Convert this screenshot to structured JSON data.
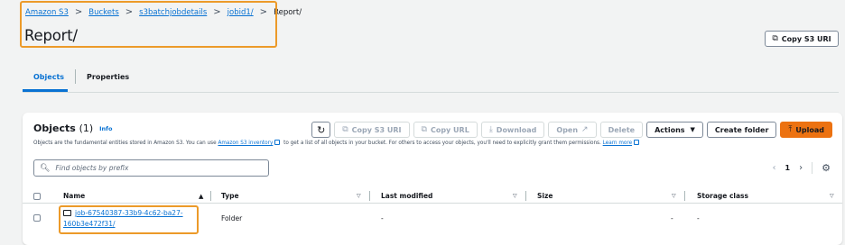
{
  "breadcrumb": {
    "items": [
      "Amazon S3",
      "Buckets",
      "s3batchjobdetails",
      "jobid1/"
    ],
    "current": "Report/",
    "separator": ">"
  },
  "page": {
    "title": "Report/"
  },
  "header_actions": {
    "copy_s3_uri": "Copy S3 URI"
  },
  "tabs": [
    {
      "label": "Objects",
      "active": true
    },
    {
      "label": "Properties",
      "active": false
    }
  ],
  "objects_panel": {
    "title": "Objects",
    "count": "(1)",
    "info": "Info",
    "description": {
      "part1": "Objects are the fundamental entities stored in Amazon S3. You can use ",
      "link1": "Amazon S3 inventory",
      "part2": " to get a list of all objects in your bucket. For others to access your objects, you'll need to explicitly grant them permissions. ",
      "link2": "Learn more"
    },
    "toolbar": {
      "refresh_icon": "refresh-icon",
      "copy_s3_uri": "Copy S3 URI",
      "copy_url": "Copy URL",
      "download": "Download",
      "open": "Open",
      "delete": "Delete",
      "actions": "Actions",
      "create_folder": "Create folder",
      "upload": "Upload"
    },
    "search": {
      "placeholder": "Find objects by prefix",
      "value": ""
    },
    "pagination": {
      "current_page": "1"
    },
    "columns": [
      "Name",
      "Type",
      "Last modified",
      "Size",
      "Storage class"
    ],
    "rows": [
      {
        "name_line1": "job-67540387-33b9-4c62-ba27-",
        "name_line2": "160b3e472f31/",
        "type": "Folder",
        "last_modified": "-",
        "size": "-",
        "storage_class": "-"
      }
    ]
  },
  "colors": {
    "accent": "#0972d3",
    "primary_button": "#ec7211",
    "highlight": "#ec9a29"
  }
}
